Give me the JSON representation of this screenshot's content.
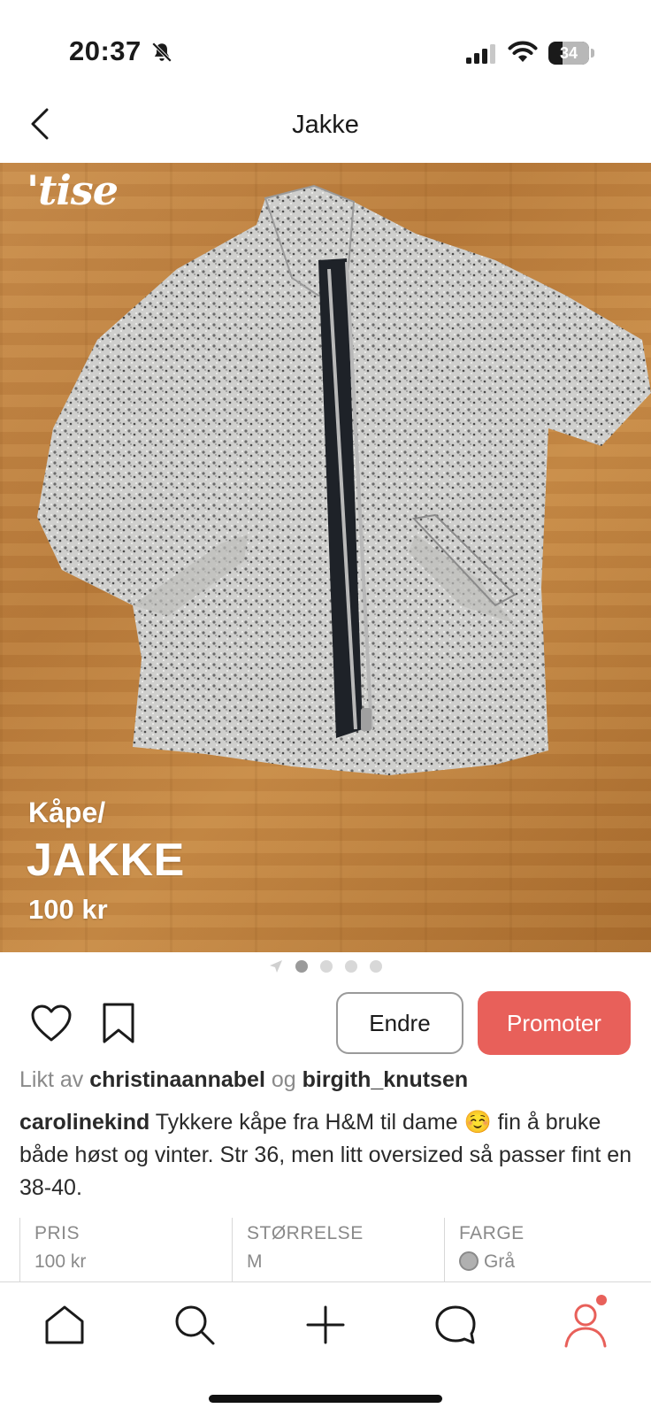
{
  "status_bar": {
    "time": "20:37",
    "battery": "34",
    "battery_level": 0.34,
    "icons": [
      "bell-slash-icon",
      "cellular-signal-icon",
      "wifi-icon",
      "battery-icon"
    ]
  },
  "header": {
    "title": "Jakke",
    "back_icon": "chevron-left-icon"
  },
  "photo": {
    "logo": "'tise",
    "category": "Kåpe/",
    "title": "JAKKE",
    "price": "100 kr",
    "page_count": 4,
    "active_page": 1
  },
  "actions": {
    "like_icon": "heart-icon",
    "save_icon": "bookmark-icon",
    "edit_label": "Endre",
    "promote_label": "Promoter",
    "promote_color": "#e8605a"
  },
  "likes": {
    "prefix": "Likt av",
    "user1": "christinaannabel",
    "conjunction": "og",
    "user2": "birgith_knutsen"
  },
  "description": {
    "username": "carolinekind",
    "text": "Tykkere kåpe fra H&M til dame ☺️ fin å bruke både høst og vinter. Str 36, men litt oversized så passer fint en 38-40."
  },
  "info": [
    {
      "label": "PRIS",
      "value": "100 kr"
    },
    {
      "label": "STØRRELSE",
      "value": "M"
    },
    {
      "label": "FARGE",
      "value": "Grå",
      "swatch_color": "#b0b0b0"
    }
  ],
  "tab_bar": {
    "tabs": [
      "home-icon",
      "search-icon",
      "plus-icon",
      "chat-icon",
      "profile-icon"
    ],
    "active_color": "#e8605a"
  }
}
